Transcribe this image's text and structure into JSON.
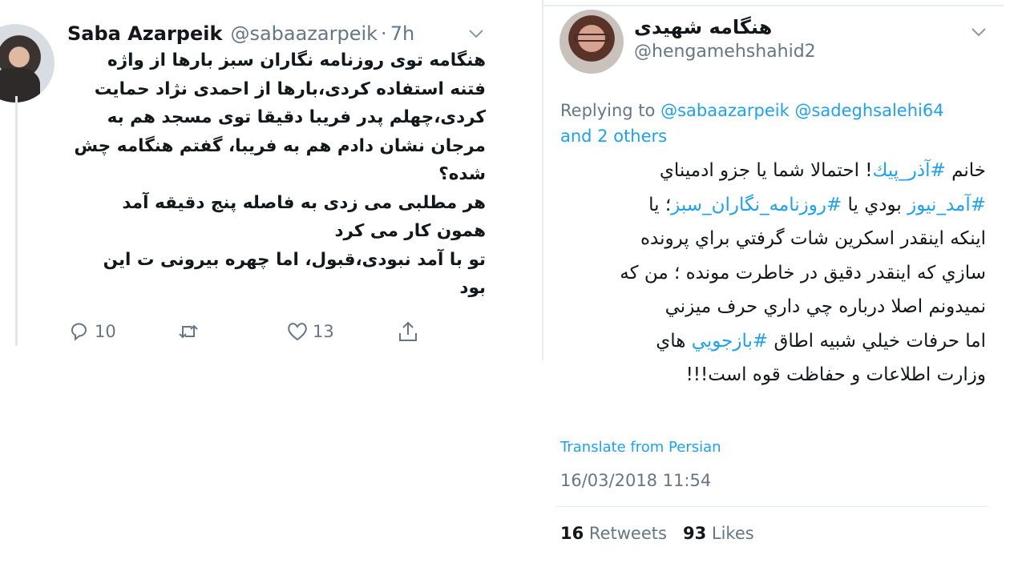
{
  "left_tweet": {
    "name": "Saba Azarpeik",
    "handle": "@sabaazarpeik",
    "separator": "·",
    "time": "7h",
    "text_lines": [
      "هنگامه توی روزنامه نگاران سبز بارها از واژه",
      "فتنه استفاده کردی،بارها از احمدی نژاد حمایت",
      "کردی،چهلم پدر فریبا دقیقا توی مسجد هم به",
      "مرجان نشان دادم هم به فریبا، گفتم هنگامه چش",
      "شده؟",
      "هر مطلبی می زدی به فاصله پنج دقیقه آمد",
      "همون کار می کرد",
      "تو با آمد نبودی،قبول، اما چهره بیرونی ت این",
      "بود"
    ],
    "replies": "10",
    "likes": "13",
    "icons": {
      "reply": "reply-icon",
      "retweet": "retweet-icon",
      "like": "heart-icon",
      "share": "share-icon",
      "menu": "chevron-down-icon"
    }
  },
  "right_tweet": {
    "name": "هنگامه شهیدی",
    "handle": "@hengamehshahid2",
    "replying_prefix": "Replying to",
    "replying_mention_1": "@sabaazarpeik",
    "replying_mention_2": "@sadeghsalehi64",
    "replying_others": "and 2 others",
    "line1_a": "خانم",
    "line1_tag": "#آذر_پيك",
    "line1_b": "! احتمالا شما يا جزو ادمیناي",
    "line2_tag1": "#آمد_نيوز",
    "line2_mid": " بودي يا ",
    "line2_tag2": "#روزنامه_نگاران_سبز",
    "line2_end": "؛ يا",
    "line3": "اينكه اينقدر اسكرين شات گرفتي براي پرونده",
    "line4": "سازي كه اينقدر دقيق در خاطرت مونده ؛ من كه",
    "line5": "نميدونم اصلا درباره چي داري حرف ميزني",
    "line6_a": "اما حرفات خيلي شبيه اطاق ",
    "line6_tag": "#بازجويي",
    "line6_b": " هاي",
    "line7": "وزارت اطلاعات و حفاظت قوه است!!!",
    "translate": "Translate from Persian",
    "date": "16/03/2018 11:54",
    "retweets_count": "16",
    "retweets_label": "Retweets",
    "likes_count": "93",
    "likes_label": "Likes",
    "menu_icon": "chevron-down-icon"
  },
  "colors": {
    "link": "#1da1f2",
    "muted": "#657786",
    "text": "#14171a",
    "divider": "#e6ecf0"
  }
}
